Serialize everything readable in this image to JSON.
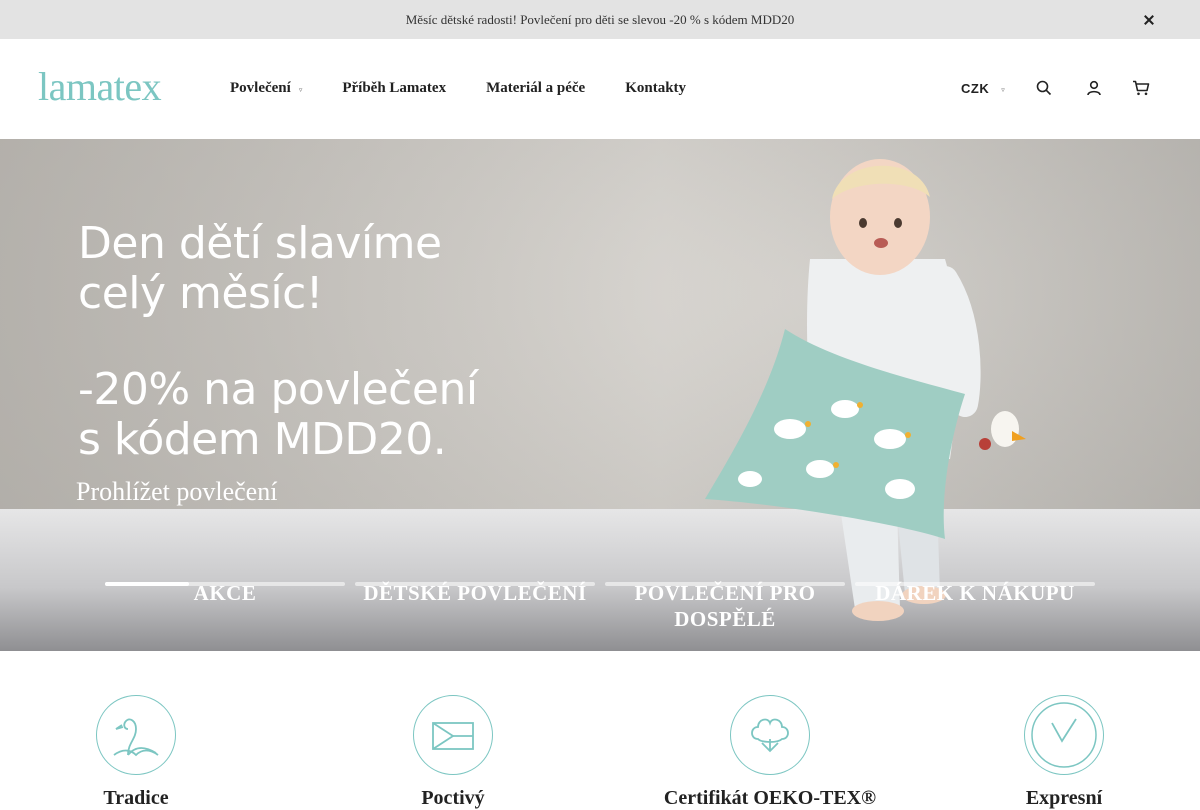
{
  "announcement": {
    "text": "Měsíc dětské radosti! Povlečení pro děti se slevou -20 % s kódem MDD20",
    "close_icon": "close-icon"
  },
  "header": {
    "logo": "lamatex",
    "nav": [
      {
        "label": "Povlečení",
        "has_dropdown": true
      },
      {
        "label": "Příběh Lamatex"
      },
      {
        "label": "Materiál a péče"
      },
      {
        "label": "Kontakty"
      }
    ],
    "currency": "CZK",
    "icons": [
      "search-icon",
      "user-icon",
      "cart-icon"
    ]
  },
  "hero": {
    "headline_1": "Den dětí slavíme",
    "headline_2": "celý měsíc!",
    "headline_3": "-20% na povlečení",
    "headline_4": "s kódem MDD20.",
    "cta": "Prohlížet povlečení",
    "slides": [
      {
        "label": "AKCE",
        "progress": 0.35
      },
      {
        "label": "DĚTSKÉ POVLEČENÍ",
        "progress": 0
      },
      {
        "label": "POVLEČENÍ PRO DOSPĚLÉ",
        "progress": 0
      },
      {
        "label": "DÁREK K NÁKUPU",
        "progress": 0
      }
    ]
  },
  "features": [
    {
      "title": "Tradice",
      "icon": "swan-icon"
    },
    {
      "title": "Poctivý",
      "icon": "flag-icon"
    },
    {
      "title": "Certifikát OEKO-TEX®",
      "icon": "cotton-icon"
    },
    {
      "title": "Expresní",
      "icon": "check-icon"
    }
  ],
  "colors": {
    "accent": "#7cc6c2",
    "announce_bg": "#e3e3e3",
    "text": "#222222"
  }
}
